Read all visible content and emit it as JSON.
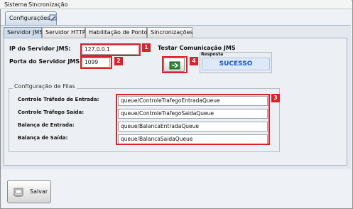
{
  "menu": {
    "items": [
      "Sistema",
      "Sincronização"
    ]
  },
  "top_tab": {
    "label": "Configurações"
  },
  "tabs": [
    "Servidor JMS",
    "Servidor HTTP",
    "Habilitação de Pontos",
    "Sincronizações"
  ],
  "jms": {
    "ip_label": "IP do Servidor JMS:",
    "ip_value": "127.0.0.1",
    "port_label": "Porta do Servidor JMS:",
    "port_value": "1099"
  },
  "test": {
    "title": "Testar Comunicação JMS",
    "response_label": "Resposta",
    "response_value": "SUCESSO"
  },
  "queues": {
    "legend": "Configuração de Filas",
    "rows": [
      {
        "label": "Controle Tráfedo de Entrada:",
        "value": "queue/ControleTrafegoEntradaQueue"
      },
      {
        "label": "Controle Tráfego Saída:",
        "value": "queue/ControleTrafegoSaidaQueue"
      },
      {
        "label": "Balança de Entrada:",
        "value": "queue/BalancaEntradaQueue"
      },
      {
        "label": "Balança de Saída:",
        "value": "queue/BalancaSaidaQueue"
      }
    ]
  },
  "badges": [
    "1",
    "2",
    "3",
    "4"
  ],
  "save": {
    "label": "Salvar"
  },
  "colors": {
    "highlight": "#d8232a",
    "success": "#1a56c6"
  }
}
